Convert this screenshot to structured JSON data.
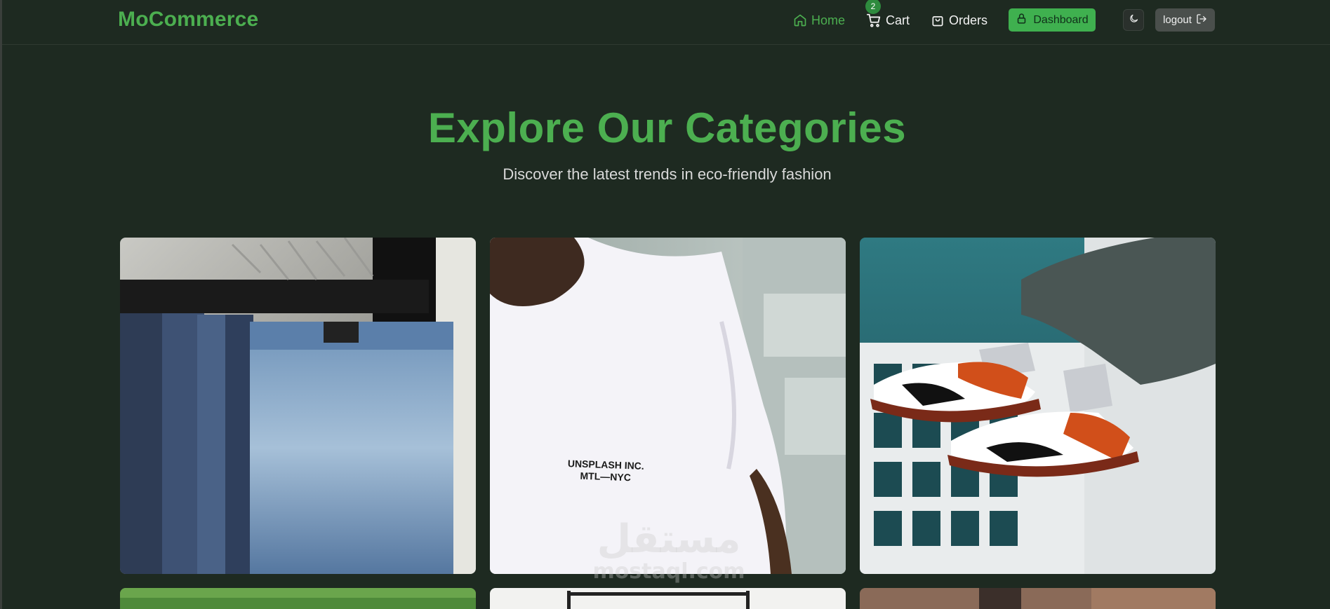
{
  "brand": "MoCommerce",
  "nav": {
    "home_label": "Home",
    "cart_label": "Cart",
    "cart_count": "2",
    "orders_label": "Orders",
    "dashboard_label": "Dashboard",
    "logout_label": "logout",
    "icons": {
      "home": "home-icon",
      "cart": "cart-icon",
      "orders": "shopping-bag-icon",
      "dashboard": "lock-icon",
      "theme": "moon-icon",
      "logout": "logout-icon"
    }
  },
  "hero": {
    "title": "Explore Our Categories",
    "subtitle": "Discover the latest trends in eco-friendly fashion"
  },
  "categories": [
    {
      "image": "jeans-on-hangers"
    },
    {
      "image": "white-tshirt",
      "print_line1": "UNSPLASH INC.",
      "print_line2": "MTL—NYC"
    },
    {
      "image": "sneakers"
    },
    {
      "image": "grass"
    },
    {
      "image": "clothing-rack"
    },
    {
      "image": "brick-wall"
    }
  ],
  "watermark": {
    "arabic": "مستقل",
    "latin": "mostaql.com"
  },
  "colors": {
    "background": "#1e2a21",
    "accent": "#4caf50",
    "dashboard_button": "#3fb04f",
    "logout_button": "#4a4f4c"
  }
}
